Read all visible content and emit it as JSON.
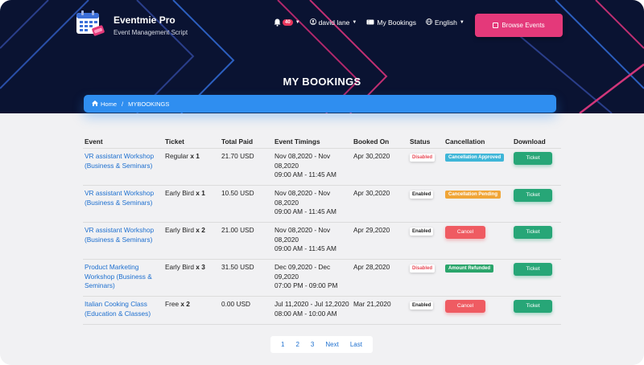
{
  "brand": {
    "name": "Eventmie Pro",
    "subtitle": "Event Management Script"
  },
  "nav": {
    "notifications_count": "40",
    "user": "david lane",
    "my_bookings": "My Bookings",
    "language": "English",
    "browse_events": "Browse Events"
  },
  "page": {
    "title": "MY BOOKINGS"
  },
  "breadcrumb": {
    "home": "Home",
    "separator": "/",
    "current": "MYBOOKINGS"
  },
  "table": {
    "headers": [
      "Event",
      "Ticket",
      "Total Paid",
      "Event Timings",
      "Booked On",
      "Status",
      "Cancellation",
      "Download"
    ],
    "rows": [
      {
        "event": "VR assistant Workshop (Business & Seminars)",
        "ticket": "Regular",
        "qty": "x 1",
        "paid": "21.70 USD",
        "timing_dates": "Nov 08,2020 - Nov 08,2020",
        "timing_time": "09:00 AM - 11:45 AM",
        "booked": "Apr 30,2020",
        "status": "Disabled",
        "cancellation": "Cancellation Approved",
        "download": "Ticket"
      },
      {
        "event": "VR assistant Workshop (Business & Seminars)",
        "ticket": "Early Bird",
        "qty": "x 1",
        "paid": "10.50 USD",
        "timing_dates": "Nov 08,2020 - Nov 08,2020",
        "timing_time": "09:00 AM - 11:45 AM",
        "booked": "Apr 30,2020",
        "status": "Enabled",
        "cancellation": "Cancellation Pending",
        "download": "Ticket"
      },
      {
        "event": "VR assistant Workshop (Business & Seminars)",
        "ticket": "Early Bird",
        "qty": "x 2",
        "paid": "21.00 USD",
        "timing_dates": "Nov 08,2020 - Nov 08,2020",
        "timing_time": "09:00 AM - 11:45 AM",
        "booked": "Apr 29,2020",
        "status": "Enabled",
        "cancellation": "Cancel",
        "download": "Ticket"
      },
      {
        "event": "Product Marketing Workshop (Business & Seminars)",
        "ticket": "Early Bird",
        "qty": "x 3",
        "paid": "31.50 USD",
        "timing_dates": "Dec 09,2020 - Dec 09,2020",
        "timing_time": "07:00 PM - 09:00 PM",
        "booked": "Apr 28,2020",
        "status": "Disabled",
        "cancellation": "Amount Refunded",
        "download": "Ticket"
      },
      {
        "event": "Italian Cooking Class (Education & Classes)",
        "ticket": "Free",
        "qty": "x 2",
        "paid": "0.00 USD",
        "timing_dates": "Jul 11,2020 - Jul 12,2020",
        "timing_time": "08:00 AM - 10:00 AM",
        "booked": "Mar 21,2020",
        "status": "Enabled",
        "cancellation": "Cancel",
        "download": "Ticket"
      }
    ]
  },
  "pagination": {
    "pages": [
      "1",
      "2",
      "3"
    ],
    "next": "Next",
    "last": "Last"
  },
  "colors": {
    "hero_bg": "#0a1332",
    "accent_pink": "#e4397a",
    "breadcrumb_blue": "#2f8ef0",
    "link_blue": "#1d6fcf",
    "ticket_green": "#27a677",
    "cancel_red": "#ef5b62",
    "approved_cyan": "#3fb6d8",
    "pending_orange": "#f0a537",
    "refunded_green": "#2aa56b"
  }
}
